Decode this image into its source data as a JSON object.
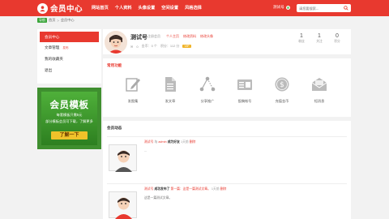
{
  "header": {
    "logo_text": "会员中心",
    "nav": [
      "网站首页",
      "个人资料",
      "头像设置",
      "空间设置",
      "风格选择"
    ],
    "user_name": "测试号",
    "search_placeholder": "请您要搜索..."
  },
  "breadcrumb": {
    "badge": "导航",
    "items": [
      "首页",
      "会员中心"
    ],
    "sep": ">"
  },
  "sidebar": {
    "items": [
      {
        "label": "会员中心",
        "tag": ""
      },
      {
        "label": "文章管理",
        "tag": "发布"
      },
      {
        "label": "我的收藏夹",
        "tag": ""
      },
      {
        "label": "退出",
        "tag": ""
      }
    ]
  },
  "ad": {
    "title": "会员模板",
    "line1": "每套模板只需5元",
    "line2": "部分模板会员可下载，了解更多",
    "button": "了解一下"
  },
  "profile": {
    "name": "测试号",
    "role": "注册会员",
    "links": [
      "个人主页",
      "修改资料",
      "修改头像"
    ],
    "meta": [
      "0",
      "金币：0 个",
      "积分：112 分"
    ],
    "badge": "VIP",
    "stats": [
      {
        "num": "1",
        "label": "粉丝"
      },
      {
        "num": "1",
        "label": "关注"
      },
      {
        "num": "0",
        "label": "积分"
      }
    ]
  },
  "functions": {
    "title": "常用功能",
    "items": [
      {
        "label": "发图集",
        "icon": "edit-icon"
      },
      {
        "label": "发文章",
        "icon": "document-icon"
      },
      {
        "label": "分享推广",
        "icon": "share-icon"
      },
      {
        "label": "投稿帐号",
        "icon": "id-card-icon"
      },
      {
        "label": "充值金币",
        "icon": "coin-icon"
      },
      {
        "label": "短消息",
        "icon": "envelope-icon"
      }
    ]
  },
  "activity": {
    "title": "会员动态",
    "items": [
      {
        "user": "测试号",
        "verb": "与",
        "target": "admin",
        "action": "成为好友",
        "time": "1天前",
        "del": "删除",
        "body": "..."
      },
      {
        "user": "测试号",
        "verb": "",
        "target": "",
        "action": "成功发布了",
        "link": "第一篇：这是一篇测试文章。",
        "time": "1天前",
        "del": "删除",
        "body": "这是一篇测试文章。"
      }
    ]
  },
  "colors": {
    "accent": "#e8392f",
    "bg": "#f2f2f2",
    "green": "#3aa53a"
  }
}
